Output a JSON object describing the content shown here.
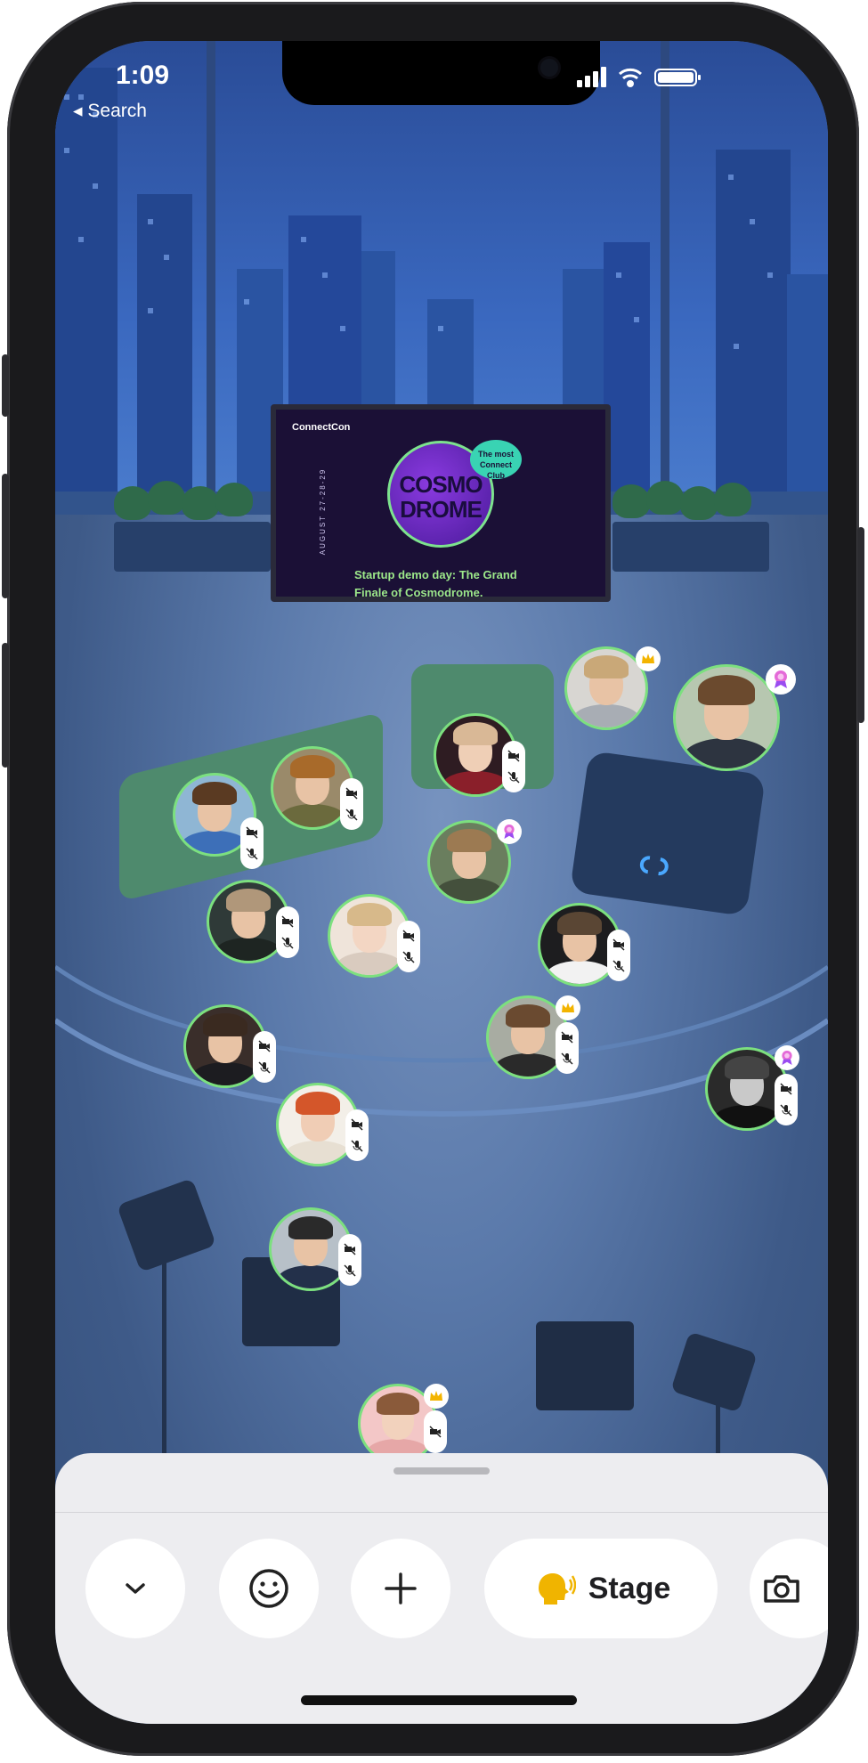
{
  "status_bar": {
    "time": "1:09",
    "back_label": "Search"
  },
  "screen_tv": {
    "brand": "ConnectCon",
    "date": "AUGUST 27-28-29",
    "logo_text": [
      "COSMO",
      "DROME"
    ],
    "badge_text": [
      "The most",
      "Connect Club"
    ],
    "tagline": "Startup demo day: The Grand Finale of Cosmodrome."
  },
  "participants": [
    {
      "name": "participant-sofa-left",
      "muted": true,
      "badge": null
    },
    {
      "name": "participant-sofa-right",
      "muted": true,
      "badge": null
    },
    {
      "name": "participant-armchair",
      "muted": true,
      "badge": null
    },
    {
      "name": "participant-top-woman",
      "muted": false,
      "badge": "crown"
    },
    {
      "name": "participant-top-right",
      "muted": false,
      "badge": "award"
    },
    {
      "name": "participant-center",
      "muted": false,
      "badge": "award"
    },
    {
      "name": "participant-left-glasses",
      "muted": true,
      "badge": null
    },
    {
      "name": "participant-blonde",
      "muted": true,
      "badge": null
    },
    {
      "name": "participant-right-white-shirt",
      "muted": true,
      "badge": null
    },
    {
      "name": "participant-bearded",
      "muted": true,
      "badge": null
    },
    {
      "name": "participant-glasses-crown",
      "muted": true,
      "badge": "crown"
    },
    {
      "name": "participant-bw-right",
      "muted": true,
      "badge": "award"
    },
    {
      "name": "participant-redhead",
      "muted": true,
      "badge": null
    },
    {
      "name": "participant-stage-chair",
      "muted": true,
      "badge": null
    },
    {
      "name": "participant-bottom",
      "muted": true,
      "badge": "crown"
    }
  ],
  "controls": {
    "collapse_icon": "chevron-down-icon",
    "emoji_icon": "smiley-icon",
    "add_icon": "plus-icon",
    "stage_label": "Stage",
    "camera_icon": "camera-icon"
  },
  "colors": {
    "speaking_ring": "#7ce07f",
    "stage_icon": "#f0b400",
    "sky": "#3a68bf"
  }
}
